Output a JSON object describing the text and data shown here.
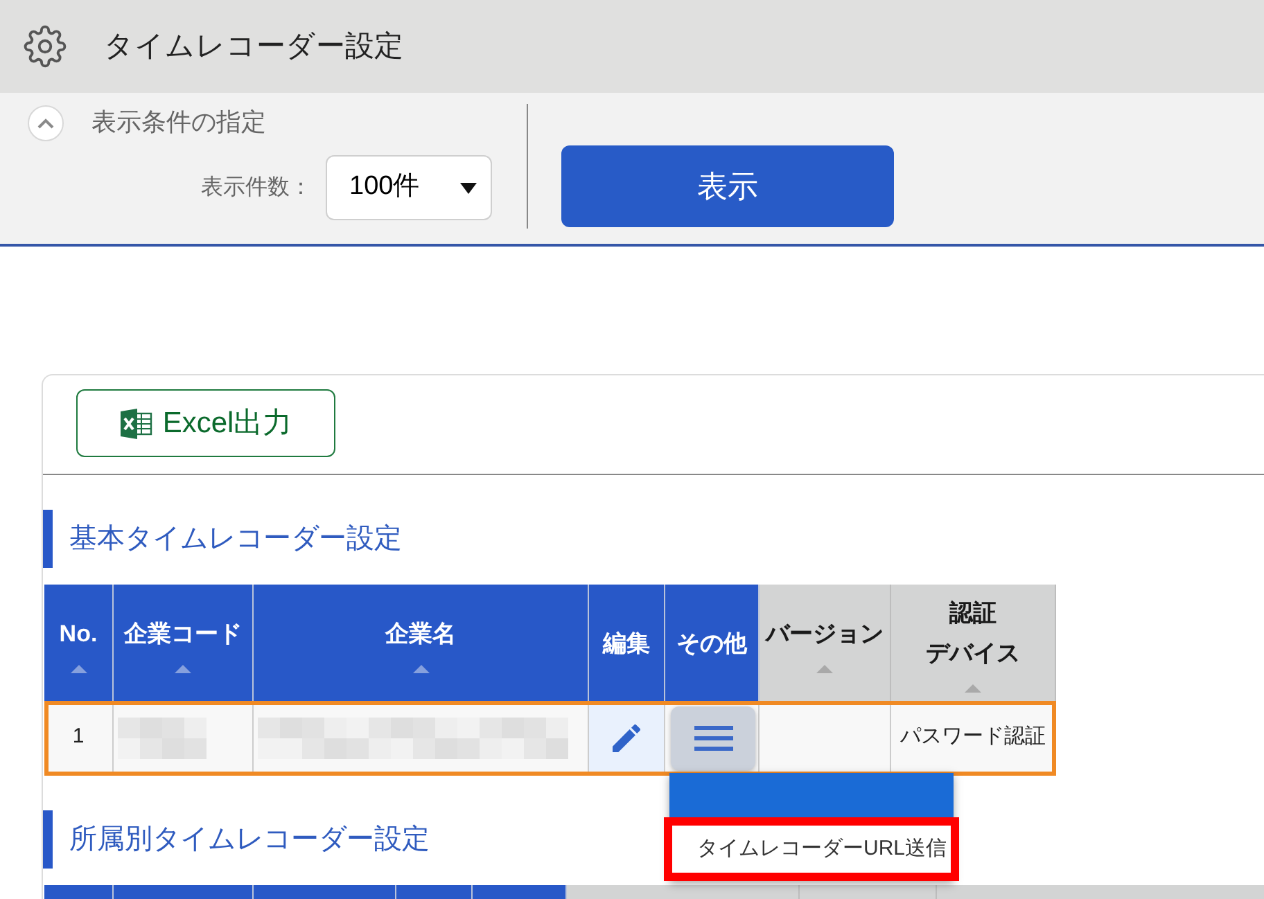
{
  "window": {
    "title": "タイムレコーダー設定"
  },
  "filter_panel": {
    "expanded": true,
    "title": "表示条件の指定",
    "count_label": "表示件数：",
    "count_select": {
      "value": "100件"
    },
    "show_button": {
      "label": "表示"
    }
  },
  "toolbar": {
    "excel_button": {
      "label": "Excel出力"
    }
  },
  "sections": [
    {
      "title": "基本タイムレコーダー設定",
      "table": {
        "columns": [
          {
            "lines": [
              "No."
            ],
            "color": "#2858c8",
            "sortable": true
          },
          {
            "lines": [
              "企業コード"
            ],
            "color": "#2858c8",
            "sortable": true
          },
          {
            "lines": [
              "企業名"
            ],
            "color": "#2858c8",
            "sortable": true
          },
          {
            "lines": [
              "編集"
            ],
            "color": "#2858c8",
            "sortable": false
          },
          {
            "lines": [
              "その他"
            ],
            "color": "#2858c8",
            "sortable": false
          },
          {
            "lines": [
              "バージョン"
            ],
            "color": "#d3d4d4",
            "sortable": true
          },
          {
            "lines": [
              "認証",
              "デバイス"
            ],
            "color": "#d3d4d4",
            "sortable": true
          }
        ],
        "rows": [
          {
            "selected": true,
            "cells": [
              {
                "kind": "text",
                "text": "1"
              },
              {
                "kind": "redacted"
              },
              {
                "kind": "redacted"
              },
              {
                "kind": "edit"
              },
              {
                "kind": "menu",
                "expanded": true,
                "items": [
                  {
                    "selected": true,
                    "outlined": false
                  },
                  {
                    "label": "タイムレコーダーURL送信",
                    "selected": false,
                    "outlined": true
                  }
                ]
              },
              {
                "kind": "blank"
              },
              {
                "kind": "text",
                "text": "パスワード認証"
              }
            ]
          }
        ]
      }
    },
    {
      "title": "所属別タイムレコーダー設定",
      "table": {
        "columns": [
          {
            "color": "#2858c8"
          },
          {
            "color": "#2858c8"
          },
          {
            "color": "#2858c8"
          },
          {
            "color": "#2858c8"
          },
          {
            "color": "#2858c8"
          },
          {
            "color": "#d3d4d4"
          },
          {
            "color": "#d3d4d4"
          },
          {
            "color": "#d3d4d4"
          }
        ]
      }
    }
  ]
}
